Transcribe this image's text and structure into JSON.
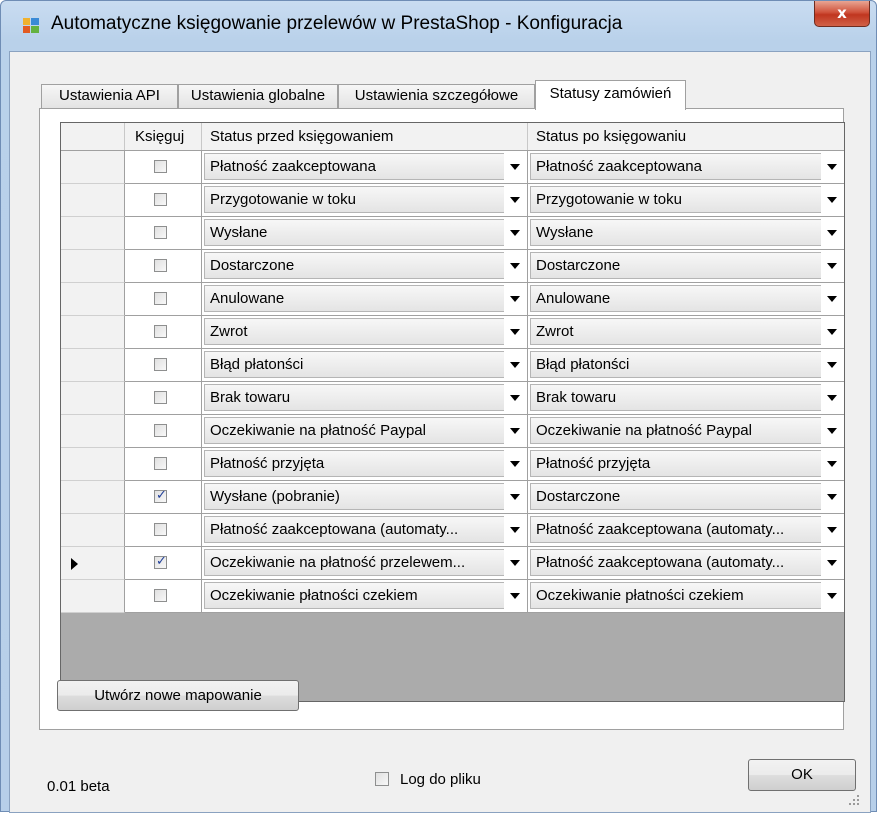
{
  "window": {
    "title": "Automatyczne księgowanie przelewów w PrestaShop - Konfiguracja",
    "close_glyph": "x"
  },
  "tabs": [
    {
      "label": "Ustawienia API",
      "active": false
    },
    {
      "label": "Ustawienia globalne",
      "active": false
    },
    {
      "label": "Ustawienia szczegółowe",
      "active": false
    },
    {
      "label": "Statusy zamówień",
      "active": true
    }
  ],
  "grid": {
    "columns": {
      "book": "Księguj",
      "before": "Status przed księgowaniem",
      "after": "Status po księgowaniu"
    },
    "rows": [
      {
        "checked": false,
        "current": false,
        "before": "Płatność zaakceptowana",
        "after": "Płatność zaakceptowana"
      },
      {
        "checked": false,
        "current": false,
        "before": "Przygotowanie w toku",
        "after": "Przygotowanie w toku"
      },
      {
        "checked": false,
        "current": false,
        "before": "Wysłane",
        "after": "Wysłane"
      },
      {
        "checked": false,
        "current": false,
        "before": "Dostarczone",
        "after": "Dostarczone"
      },
      {
        "checked": false,
        "current": false,
        "before": "Anulowane",
        "after": "Anulowane"
      },
      {
        "checked": false,
        "current": false,
        "before": "Zwrot",
        "after": "Zwrot"
      },
      {
        "checked": false,
        "current": false,
        "before": "Błąd płatonści",
        "after": "Błąd płatonści"
      },
      {
        "checked": false,
        "current": false,
        "before": "Brak towaru",
        "after": "Brak towaru"
      },
      {
        "checked": false,
        "current": false,
        "before": "Oczekiwanie na płatność Paypal",
        "after": "Oczekiwanie na płatność Paypal"
      },
      {
        "checked": false,
        "current": false,
        "before": "Płatność przyjęta",
        "after": "Płatność przyjęta"
      },
      {
        "checked": true,
        "current": false,
        "before": "Wysłane (pobranie)",
        "after": "Dostarczone"
      },
      {
        "checked": false,
        "current": false,
        "before": "Płatność zaakceptowana (automaty...",
        "after": "Płatność zaakceptowana (automaty..."
      },
      {
        "checked": true,
        "current": true,
        "before": "Oczekiwanie na płatność przelewem...",
        "after": "Płatność zaakceptowana (automaty..."
      },
      {
        "checked": false,
        "current": false,
        "before": "Oczekiwanie płatności czekiem",
        "after": "Oczekiwanie płatności czekiem"
      }
    ]
  },
  "buttons": {
    "new_mapping": "Utwórz nowe mapowanie",
    "ok": "OK"
  },
  "footer": {
    "version": "0.01 beta",
    "log_label": "Log do pliku",
    "log_checked": false
  },
  "icons": {
    "app": "app-window-icon",
    "row_indicator": "current-row-arrow-icon",
    "dropdown": "chevron-down-icon"
  }
}
